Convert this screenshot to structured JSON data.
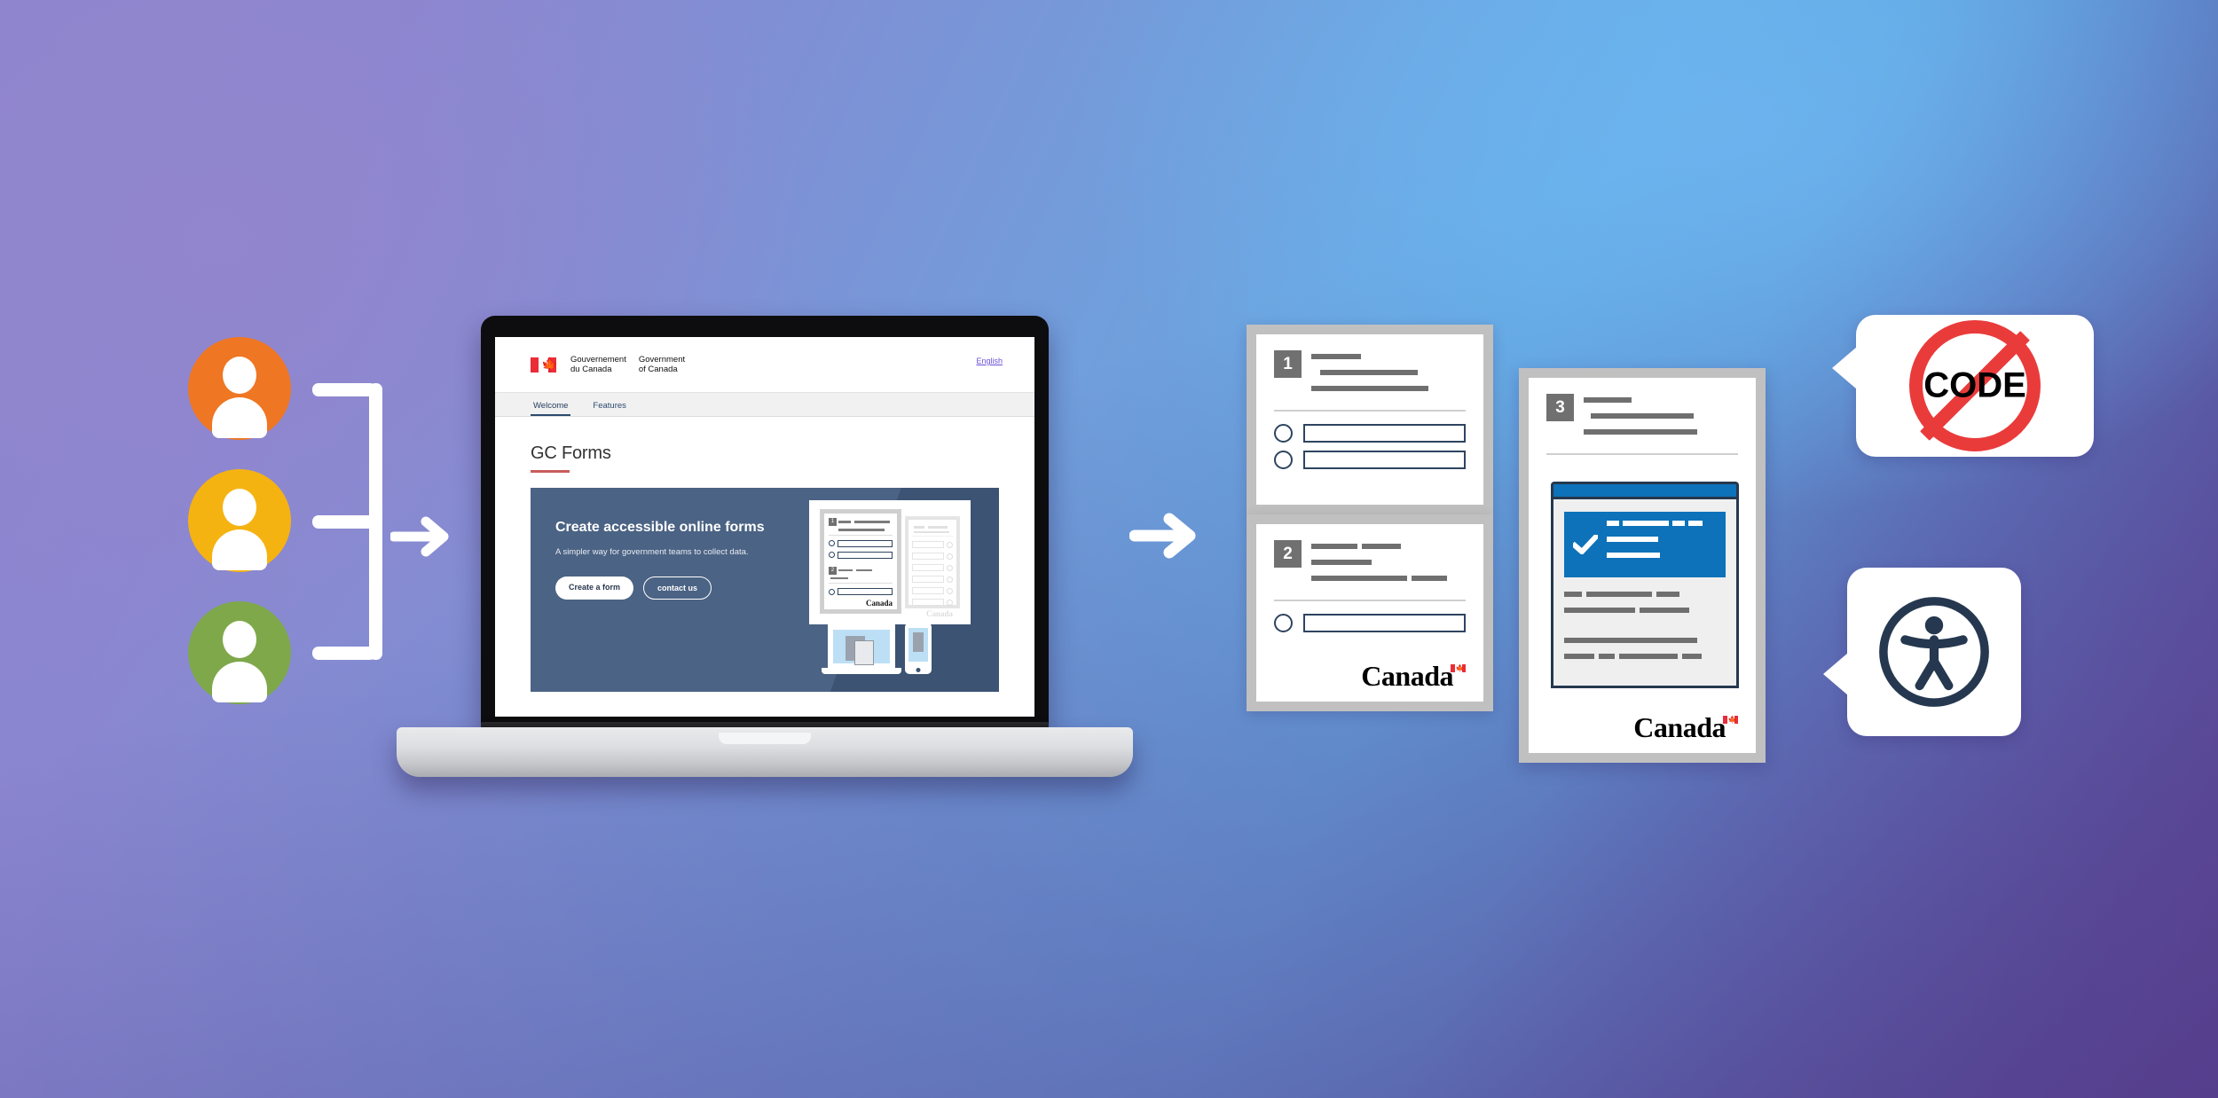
{
  "scene": {
    "title": "GC Forms product illustration",
    "background_colors": {
      "top_left": "#8d84cf",
      "top_right": "#63b0e8",
      "bottom": "#55449a"
    }
  },
  "users": {
    "label": "government team members",
    "avatars": [
      {
        "name": "user-avatar-orange",
        "color": "#ef7622"
      },
      {
        "name": "user-avatar-yellow",
        "color": "#f5b312"
      },
      {
        "name": "user-avatar-green",
        "color": "#7fa84b"
      }
    ]
  },
  "flow": {
    "bracket_label": "users merge",
    "arrow_1_label": "to",
    "arrow_2_label": "produces"
  },
  "laptop": {
    "device": "laptop",
    "page": {
      "fip": {
        "fr": "Gouvernement\ndu Canada",
        "en": "Government\nof Canada",
        "fr_line1": "Gouvernement",
        "fr_line2": "du Canada",
        "en_line1": "Government",
        "en_line2": "of Canada"
      },
      "language_toggle": "English",
      "tabs": [
        {
          "label": "Welcome",
          "active": true
        },
        {
          "label": "Features",
          "active": false
        }
      ],
      "site_title": "GC Forms",
      "hero": {
        "heading": "Create accessible online forms",
        "subheading": "A simpler way for government teams to collect data.",
        "primary_button": "Create a form",
        "secondary_button": "contact us",
        "background_color": "#4b6384"
      },
      "illustration": {
        "bubble_form_numbers": [
          "1",
          "2"
        ],
        "wordmark": "Canada",
        "devices": [
          "laptop",
          "phone"
        ]
      }
    }
  },
  "form_cards": [
    {
      "name": "form-card-1",
      "number": "1",
      "options": 2,
      "wordmark": null
    },
    {
      "name": "form-card-2",
      "number": "2",
      "options": 1,
      "wordmark": "Canada"
    },
    {
      "name": "form-card-3",
      "number": "3",
      "options": 0,
      "wordmark": "Canada",
      "overlay": {
        "name": "confirmation-panel",
        "accent_color": "#0d72b9",
        "icon": "checkmark"
      }
    }
  ],
  "badges": [
    {
      "name": "no-code-badge",
      "label": "CODE",
      "icon": "prohibition-sign",
      "color": "#ea3b3b"
    },
    {
      "name": "accessibility-badge",
      "label": "",
      "icon": "universal-access",
      "color": "#25384f"
    }
  ]
}
